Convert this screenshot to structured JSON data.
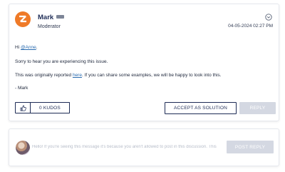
{
  "post": {
    "author": {
      "name": "Mark",
      "role": "Moderator",
      "avatar_icon": "zendesk-logo-icon",
      "avatar_color": "#ef7a27",
      "rank_icon": "rank-badge-icon"
    },
    "date": "04-05-2024 02:27 PM",
    "options_icon": "chevron-down-circle-icon",
    "body": {
      "greeting_prefix": "Hi ",
      "mention": "@Anne",
      "greeting_suffix": ".",
      "line2": "Sorry to hear you are experiencing this issue.",
      "line3_prefix": "This was originally reported ",
      "line3_link": "here",
      "line3_suffix": ". If you can share some examples, we will be happy to look into this.",
      "signature": "- Mark"
    },
    "actions": {
      "kudo_icon": "thumbs-up-icon",
      "kudos_label": "0 KUDOS",
      "accept_label": "ACCEPT AS SOLUTION",
      "reply_label": "REPLY"
    }
  },
  "reply_box": {
    "placeholder": "Hello! If you're seeing this message it's because you aren't allowed to post in this discussion. This",
    "button_label": "POST REPLY"
  },
  "colors": {
    "brand_navy": "#1d2b55",
    "link": "#2b6cb0",
    "disabled_button": "#d4d8e2",
    "avatar_orange": "#ef7a27"
  }
}
